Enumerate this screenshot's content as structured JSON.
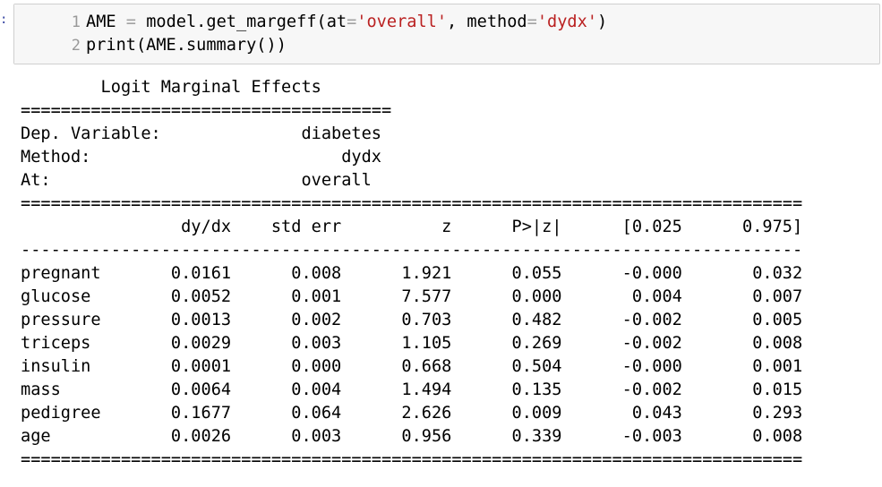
{
  "prompt_mark": ":",
  "code": {
    "line_numbers": [
      "1",
      "2"
    ],
    "line1": {
      "var": "AME",
      "op": "=",
      "call": "model.get_margeff(at",
      "eq": "=",
      "str1": "'overall'",
      "mid": ", method",
      "eq2": "=",
      "str2": "'dydx'",
      "end": ")"
    },
    "line2": "print(AME.summary())"
  },
  "output": {
    "lines": [
      "        Logit Marginal Effects       ",
      "=====================================",
      "Dep. Variable:              diabetes",
      "Method:                         dydx",
      "At:                         overall",
      "==============================================================================",
      "                dy/dx    std err          z      P>|z|      [0.025      0.975]",
      "------------------------------------------------------------------------------",
      "pregnant       0.0161      0.008      1.921      0.055      -0.000       0.032",
      "glucose        0.0052      0.001      7.577      0.000       0.004       0.007",
      "pressure       0.0013      0.002      0.703      0.482      -0.002       0.005",
      "triceps        0.0029      0.003      1.105      0.269      -0.002       0.008",
      "insulin        0.0001      0.000      0.668      0.504      -0.000       0.001",
      "mass           0.0064      0.004      1.494      0.135      -0.002       0.015",
      "pedigree       0.1677      0.064      2.626      0.009       0.043       0.293",
      "age            0.0026      0.003      0.956      0.339      -0.003       0.008",
      "=============================================================================="
    ]
  },
  "colors": {
    "string": "#ba2121",
    "operator": "#a2a2a2",
    "line_number": "#999999",
    "cell_background": "#f7f7f7"
  }
}
